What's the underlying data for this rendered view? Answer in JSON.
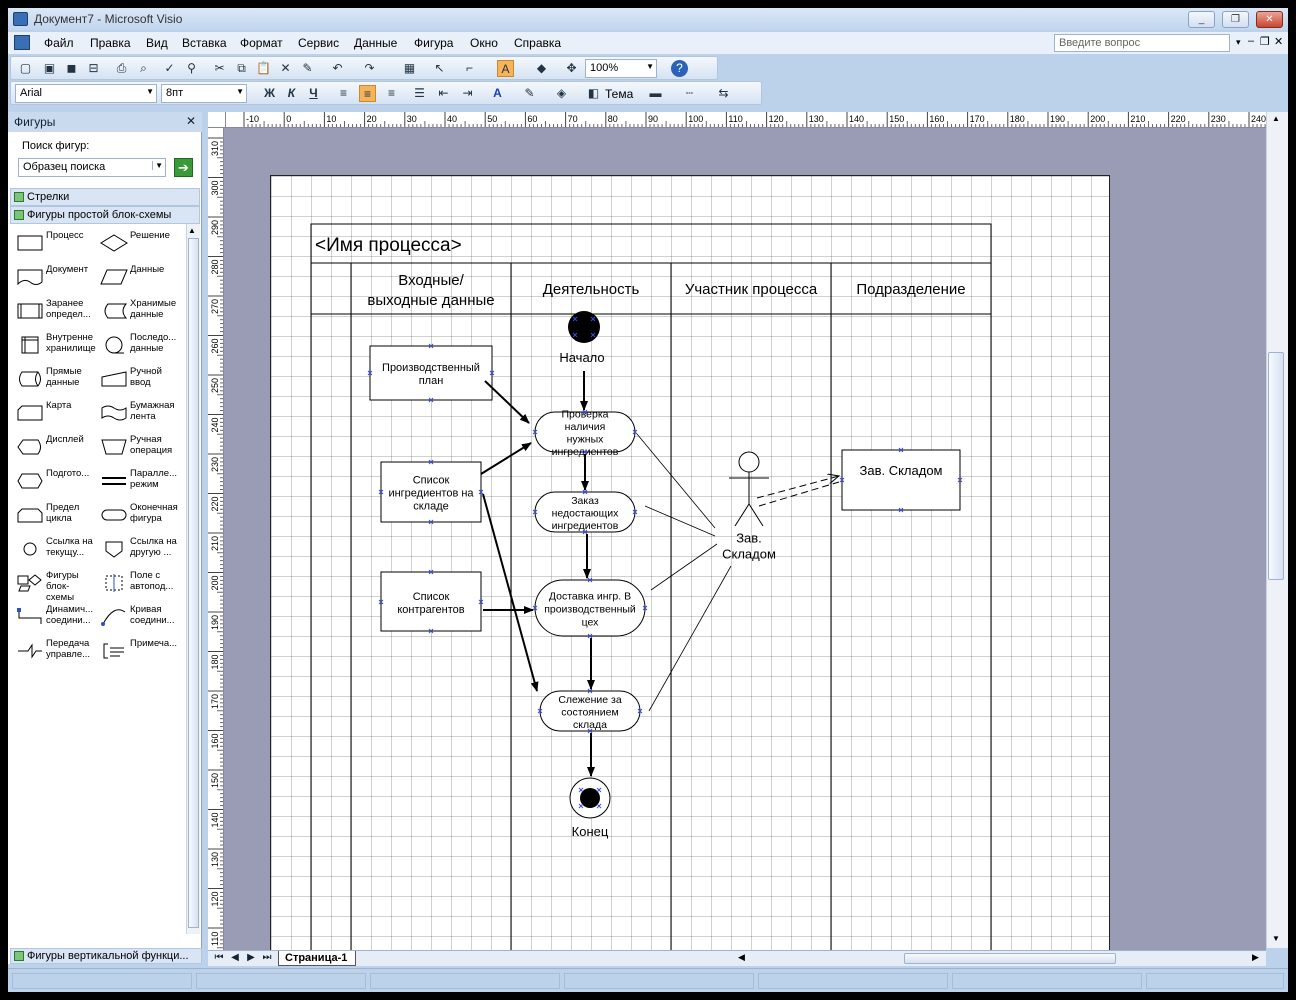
{
  "window": {
    "title": "Документ7 - Microsoft Visio",
    "buttons": {
      "minimize": "_",
      "restore": "❐",
      "close": "✕"
    }
  },
  "menu": {
    "items": [
      "Файл",
      "Правка",
      "Вид",
      "Вставка",
      "Формат",
      "Сервис",
      "Данные",
      "Фигура",
      "Окно",
      "Справка"
    ],
    "ask_placeholder": "Введите вопрос"
  },
  "toolbar": {
    "zoom": "100%",
    "font": "Arial",
    "font_size": "8пт",
    "bold": "Ж",
    "italic": "К",
    "underline": "Ч",
    "theme": "Тема",
    "accent": "#f7b35a"
  },
  "shapes_panel": {
    "title": "Фигуры",
    "search_label": "Поиск фигур:",
    "search_placeholder": "Образец поиска",
    "stencils": [
      "Стрелки",
      "Фигуры простой блок-схемы"
    ],
    "bottom_stencil": "Фигуры вертикальной функци...",
    "items": [
      {
        "label": "Процесс",
        "icon": "process-shape"
      },
      {
        "label": "Решение",
        "icon": "decision-shape"
      },
      {
        "label": "Документ",
        "icon": "document-shape"
      },
      {
        "label": "Данные",
        "icon": "data-shape"
      },
      {
        "label": "Заранее определ...",
        "icon": "predefined-shape"
      },
      {
        "label": "Хранимые данные",
        "icon": "stored-data-shape"
      },
      {
        "label": "Внутренне хранилище",
        "icon": "internal-storage-shape"
      },
      {
        "label": "Последо... данные",
        "icon": "sequential-data-shape"
      },
      {
        "label": "Прямые данные",
        "icon": "direct-data-shape"
      },
      {
        "label": "Ручной ввод",
        "icon": "manual-input-shape"
      },
      {
        "label": "Карта",
        "icon": "card-shape"
      },
      {
        "label": "Бумажная лента",
        "icon": "paper-tape-shape"
      },
      {
        "label": "Дисплей",
        "icon": "display-shape"
      },
      {
        "label": "Ручная операция",
        "icon": "manual-operation-shape"
      },
      {
        "label": "Подгото...",
        "icon": "preparation-shape"
      },
      {
        "label": "Паралле... режим",
        "icon": "parallel-mode-shape"
      },
      {
        "label": "Предел цикла",
        "icon": "loop-limit-shape"
      },
      {
        "label": "Оконечная фигура",
        "icon": "terminator-shape"
      },
      {
        "label": "Ссылка на текущу...",
        "icon": "on-page-reference-shape"
      },
      {
        "label": "Ссылка на другую ...",
        "icon": "off-page-reference-shape"
      },
      {
        "label": "Фигуры блок-схемы",
        "icon": "flowchart-shapes-shape"
      },
      {
        "label": "Поле с автопод...",
        "icon": "auto-height-box-shape"
      },
      {
        "label": "Динамич... соедини...",
        "icon": "dynamic-connector-shape"
      },
      {
        "label": "Кривая соедини...",
        "icon": "curved-connector-shape"
      },
      {
        "label": "Передача управле...",
        "icon": "control-transfer-shape"
      },
      {
        "label": "Примеча...",
        "icon": "annotation-shape"
      }
    ]
  },
  "rulers": {
    "horizontal": [
      "-10",
      "0",
      "10",
      "20",
      "30",
      "40",
      "50",
      "60",
      "70",
      "80",
      "90",
      "100",
      "110",
      "120",
      "130",
      "140",
      "150",
      "160",
      "170",
      "180",
      "190",
      "200",
      "210",
      "220",
      "230",
      "240"
    ],
    "vertical": [
      "310",
      "300",
      "290",
      "280",
      "270",
      "260",
      "250",
      "240",
      "230",
      "220",
      "210",
      "200",
      "190",
      "180",
      "170",
      "160",
      "150",
      "140",
      "130",
      "120",
      "110"
    ]
  },
  "diagram": {
    "process_title": "<Имя процесса>",
    "lanes": [
      "Входные/ выходные данные",
      "Деятельность",
      "Участник процесса",
      "Подразделение"
    ],
    "inputs": [
      "Производственный план",
      "Список ингредиентов на складе",
      "Список контрагентов"
    ],
    "start_label": "Начало",
    "end_label": "Конец",
    "activities": [
      "Проверка наличия нужных ингредиентов",
      "Заказ недостающих ингредиентов",
      "Доставка ингр. В производственный цех",
      "Слежение за состоянием склада"
    ],
    "actor": "Зав. Складом",
    "department": "Зав. Складом"
  },
  "tabs": {
    "page": "Страница-1"
  }
}
